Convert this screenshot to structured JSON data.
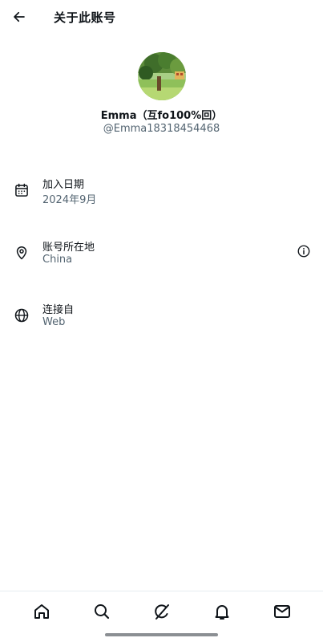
{
  "header": {
    "back_icon": "arrow-left-icon",
    "title": "关于此账号"
  },
  "profile": {
    "avatar_icon": "avatar-photo",
    "display_name": "Emma（互fo100%回）",
    "handle": "@Emma18318454468"
  },
  "info": [
    {
      "icon": "calendar-icon",
      "label": "加入日期",
      "value": "2024年9月"
    },
    {
      "icon": "location-pin-icon",
      "label": "账号所在地",
      "value": "China",
      "action_icon": "info-circle-icon"
    },
    {
      "icon": "globe-icon",
      "label": "连接自",
      "value": "Web"
    }
  ],
  "nav": [
    {
      "icon": "home-icon"
    },
    {
      "icon": "search-icon"
    },
    {
      "icon": "grok-icon"
    },
    {
      "icon": "bell-icon"
    },
    {
      "icon": "mail-icon"
    }
  ],
  "colors": {
    "text_primary": "#0f1419",
    "text_secondary": "#536471",
    "divider": "#e6ecf0"
  }
}
